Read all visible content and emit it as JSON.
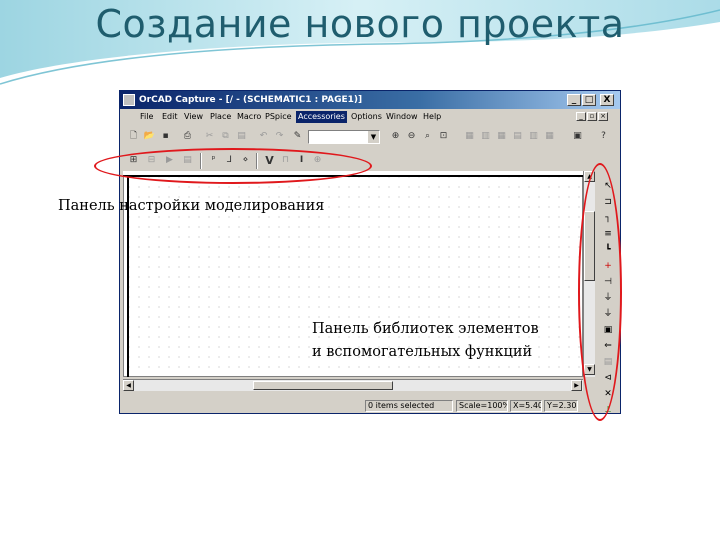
{
  "slide": {
    "title": "Создание нового проекта"
  },
  "window": {
    "title": "OrCAD Capture - [/ - (SCHEMATIC1 : PAGE1)]",
    "controls": {
      "minimize": "_",
      "maximize": "□",
      "close": "X"
    },
    "menu": [
      "File",
      "Edit",
      "View",
      "Place",
      "Macro",
      "PSpice",
      "Accessories",
      "Options",
      "Window",
      "Help"
    ],
    "active_menu_index": 6,
    "part_combo_value": "",
    "status": {
      "items_selected": "0 items selected",
      "scale": "Scale=100%",
      "x": "X=5.40",
      "y": "Y=2.30"
    }
  },
  "annotations": {
    "sim_toolbar_label": "Панель настройки моделирования",
    "palette_label_line1": "Панель библиотек элементов",
    "palette_label_line2": "и вспомогательных функций"
  },
  "colors": {
    "annotation": "#e0181c",
    "title": "#1f5d6e",
    "titlebar": "#0a246a"
  }
}
